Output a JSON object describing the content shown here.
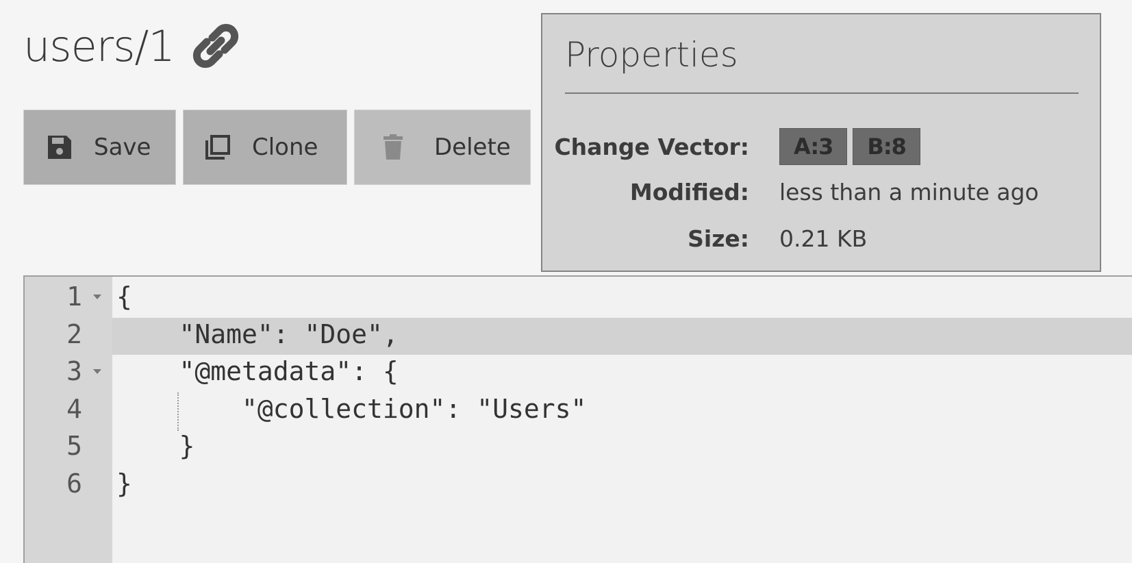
{
  "document": {
    "title": "users/1",
    "link_icon": "link-icon"
  },
  "toolbar": {
    "save_label": "Save",
    "clone_label": "Clone",
    "delete_label": "Delete",
    "save_icon": "floppy-disk-icon",
    "clone_icon": "clone-icon",
    "delete_icon": "trash-icon"
  },
  "properties": {
    "title": "Properties",
    "change_vector_label": "Change Vector:",
    "change_vector": [
      "A:3",
      "B:8"
    ],
    "modified_label": "Modified:",
    "modified_value": "less than a minute ago",
    "size_label": "Size:",
    "size_value": "0.21 KB"
  },
  "editor": {
    "active_line": 2,
    "lines": [
      {
        "num": "1",
        "text": "{",
        "foldable": true
      },
      {
        "num": "2",
        "text": "    \"Name\": \"Doe\",",
        "foldable": false
      },
      {
        "num": "3",
        "text": "    \"@metadata\": {",
        "foldable": true
      },
      {
        "num": "4",
        "text": "        \"@collection\": \"Users\"",
        "foldable": false
      },
      {
        "num": "5",
        "text": "    }",
        "foldable": false
      },
      {
        "num": "6",
        "text": "}",
        "foldable": false
      }
    ]
  },
  "colors": {
    "page_bg": "#f5f5f5",
    "panel_bg": "#d4d4d4",
    "badge_bg": "#6b6b6b",
    "button_bg": "#adadad"
  }
}
